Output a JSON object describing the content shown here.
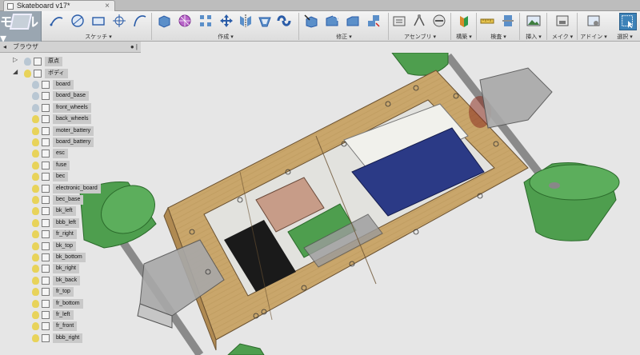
{
  "document_tab": {
    "title": "Skateboard v17*",
    "close": "×"
  },
  "ribbon": {
    "model_label": "モデル ▾",
    "groups": [
      {
        "label": "スケッチ ▾"
      },
      {
        "label": "作成 ▾"
      },
      {
        "label": "修正 ▾"
      },
      {
        "label": "アセンブリ ▾"
      },
      {
        "label": "構築 ▾"
      },
      {
        "label": "検査 ▾"
      },
      {
        "label": "挿入 ▾"
      },
      {
        "label": "メイク ▾"
      },
      {
        "label": "アドイン ▾"
      },
      {
        "label": "選択 ▾"
      }
    ]
  },
  "browser": {
    "title": "ブラウザ",
    "origin_label": "原点",
    "body_label": "ボディ",
    "bodies": [
      "board",
      "board_base",
      "front_wheels",
      "back_wheels",
      "moter_battery",
      "board_battery",
      "esc",
      "fuse",
      "bec",
      "electronic_board",
      "bec_base",
      "bk_left",
      "bbb_left",
      "fr_right",
      "bk_top",
      "bk_bottom",
      "bk_right",
      "bk_back",
      "fr_top",
      "fr_bottom",
      "fr_left",
      "fr_front",
      "bbb_right"
    ]
  },
  "colors": {
    "wood": "#c9a66b",
    "wheel": "#4e9e4e",
    "battery": "#2b3a86",
    "bulb": "#e8d35a",
    "selection": "#3d82b8"
  }
}
